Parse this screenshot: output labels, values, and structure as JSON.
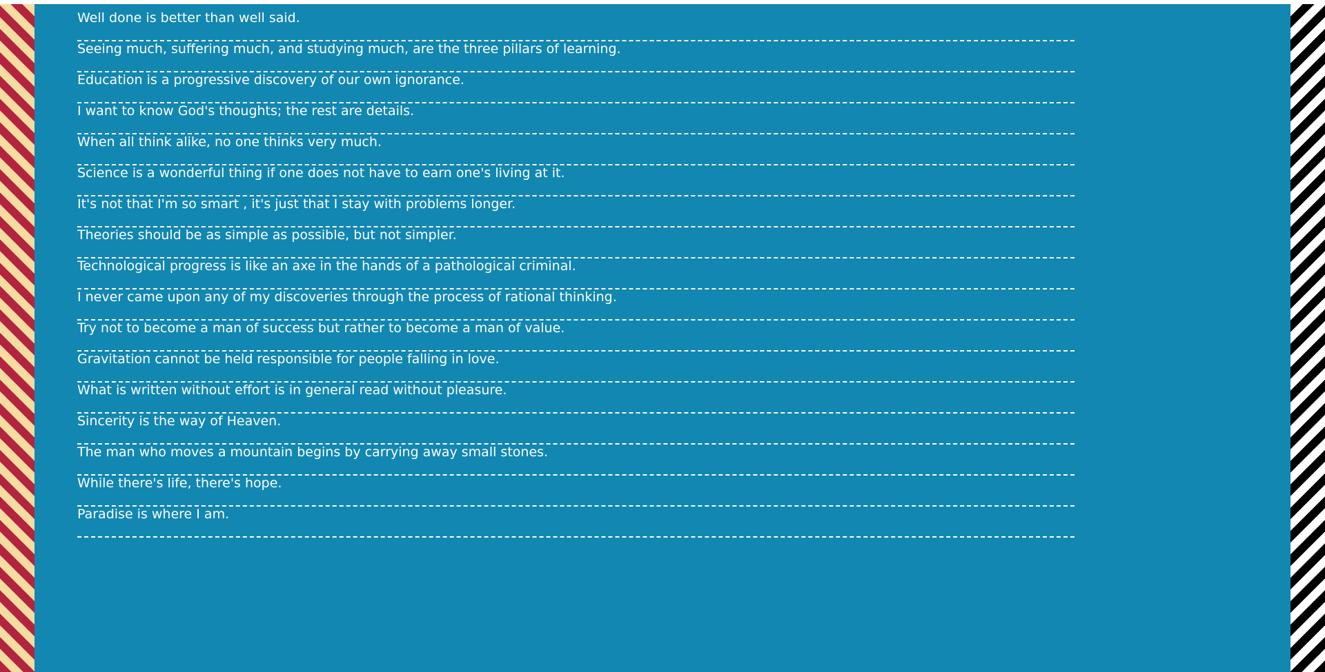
{
  "quotes": [
    "Well done is better than well said.",
    "Seeing much, suffering much, and studying much, are the three pillars of learning.",
    "Education is a progressive discovery of our own ignorance.",
    "I want to know God's thoughts; the rest are details.",
    "When all think alike, no one thinks very much.",
    "Science is a wonderful thing if one does not have to earn one's living at it.",
    "It's not that I'm so smart , it's just that I stay with problems longer.",
    "Theories should be as simple as possible, but not simpler.",
    "Technological progress is like an axe in the hands of a pathological criminal.",
    "I never came upon any of my discoveries through the process of rational thinking.",
    "Try not to become a man of success but rather to become a man of value.",
    "Gravitation cannot be held responsible for people falling in love.",
    "What is written without effort is in general read without pleasure.",
    "Sincerity is the way of Heaven.",
    "The man who moves a mountain begins by carrying away small stones.",
    "While there's life, there's hope.",
    "Paradise is where I am."
  ],
  "colors": {
    "background": "#1287b1",
    "text": "#ffffff",
    "left_stripe_primary": "#b3243f",
    "left_stripe_secondary": "#f6dca0",
    "right_stripe_primary": "#000000",
    "right_stripe_secondary": "#ffffff"
  }
}
